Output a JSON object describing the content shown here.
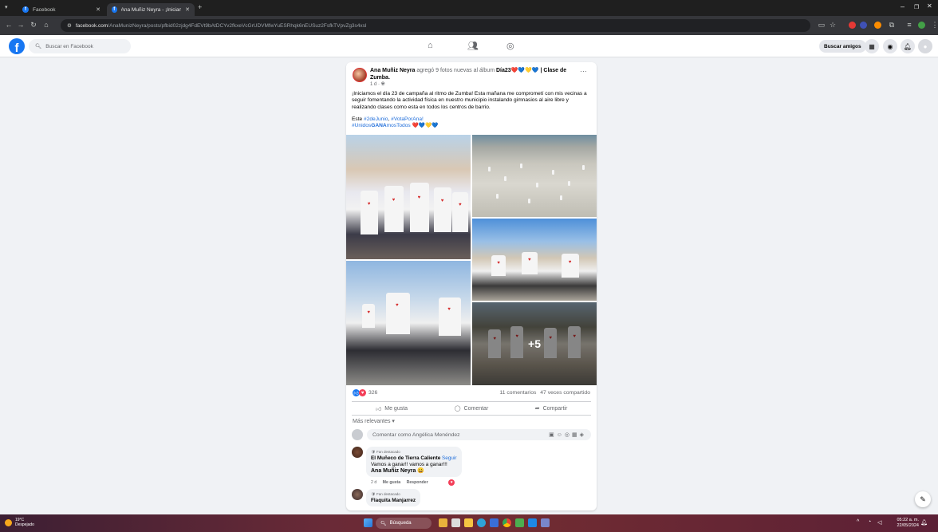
{
  "browser": {
    "tabs": [
      {
        "label": "Facebook",
        "active": false
      },
      {
        "label": "Ana Muñiz Neyra - ¡Iniciamos ...",
        "active": true
      }
    ],
    "new_tab": "+",
    "url_domain": "facebook.com",
    "url_path": "/AnaMunizNeyra/posts/pfbid02zjdg4FdEVt9bAtDCYv2fkxeVcGrUDVMfwYuESRhqk6nEUSuz2FsfkTVpvZg3s4xsl",
    "window_controls": [
      "–",
      "❐",
      "✕"
    ]
  },
  "fb_header": {
    "logo": "f",
    "search_placeholder": "Buscar en Facebook",
    "find_friends": "Buscar amigos"
  },
  "post": {
    "author": "Ana Muñiz Neyra",
    "action_text": "agregó 9 fotos nuevas al álbum",
    "album": "Día23❤️💙💛💙 | Clase de Zumba.",
    "time": "1 d ·",
    "body": "¡Iniciamos el día 23 de campaña al ritmo de Zumba! Esta mañana me comprometí con mis vecinas a seguir fomentando la actividad física en nuestro municipio instalando gimnasios al aire libre y realizando clases como esta en todos los centros de barrio.",
    "tags_prefix": "Este",
    "tag_date": "#2deJunio",
    "tag_vote": "#VotaPorAna!",
    "tag_united_a": "#Unidos",
    "tag_united_b": "GANA",
    "tag_united_c": "mosTodos",
    "tag_emojis": "❤️💙💛💙",
    "more_photos": "+5",
    "reaction_count": "326",
    "comment_count": "11 comentarios",
    "share_count": "47 veces compartido",
    "like_label": "Me gusta",
    "comment_label": "Comentar",
    "share_label": "Compartir",
    "relevance": "Más relevantes ▾",
    "comment_placeholder": "Comentar como Angélica Menéndez"
  },
  "comments": [
    {
      "badge": "Fan destacado",
      "name": "El Muñeco de Tierra Caliente",
      "follow": "Seguir",
      "text": "Vamos a ganar!! vamos a ganar!!!",
      "mention": "Ana Muñiz Neyra 😀",
      "time": "2 d",
      "like": "Me gusta",
      "reply": "Responder"
    },
    {
      "badge": "Fan destacado",
      "name": "Flaquita Manjarrez"
    }
  ],
  "taskbar": {
    "temp": "19°C",
    "weather": "Despejado",
    "search": "Búsqueda",
    "time": "05:22 a. m.",
    "date": "22/05/2024"
  },
  "colors": {
    "fb_blue": "#1877f2",
    "link_blue": "#216fdb",
    "page_bg": "#f0f2f5"
  }
}
